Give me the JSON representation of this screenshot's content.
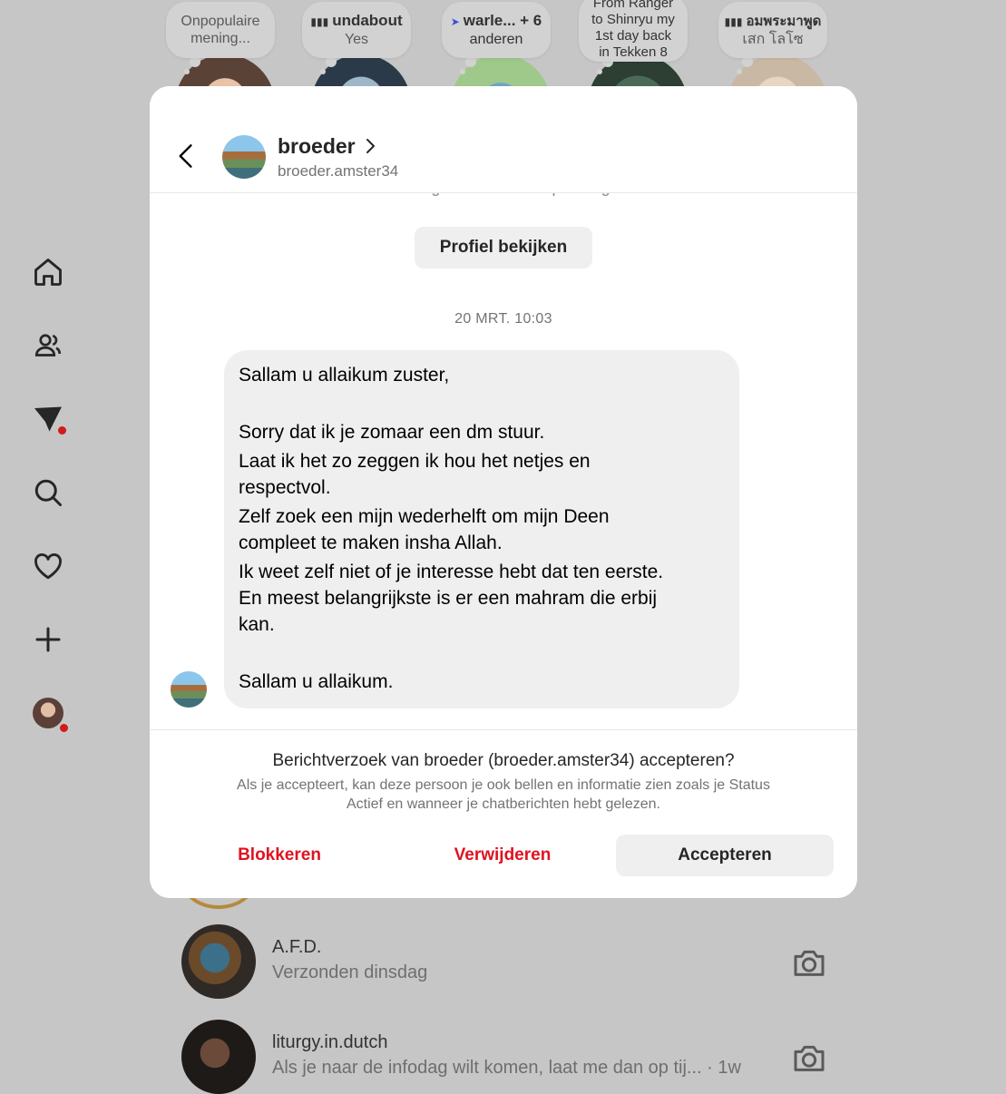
{
  "notes": [
    {
      "lines": [
        "Onpopulaire",
        "mening..."
      ],
      "music": false
    },
    {
      "top": "undabout",
      "bottom": "Yes",
      "music": true
    },
    {
      "top": "warle... + 6",
      "bottom": "anderen",
      "location": true
    },
    {
      "lines": [
        "From Ranger",
        "to Shinryu my",
        "1st day back",
        "in Tekken 8"
      ],
      "music": false
    },
    {
      "top": "อมพระมาพูด",
      "bottom": "เสก โลโซ",
      "music": true
    }
  ],
  "sidebar": {
    "items": [
      "home-icon",
      "contacts-icon",
      "messages-icon",
      "search-icon",
      "heart-icon",
      "create-icon",
      "profile-avatar"
    ]
  },
  "dm": {
    "header": {
      "name": "broeder",
      "handle": "broeder.amster34"
    },
    "peek_text": "Jullie volgen elkaar niet op Instagram",
    "profile_button": "Profiel bekijken",
    "timestamp": "20 MRT. 10:03",
    "message_lines": [
      "Sallam u allaikum zuster,",
      "Sorry dat ik je zomaar een dm stuur.",
      "Laat ik het zo zeggen ik hou het netjes en",
      "respectvol.",
      "Zelf zoek een mijn wederhelft om mijn Deen",
      "compleet te maken insha Allah.",
      "Ik weet zelf niet of je interesse hebt dat ten eerste.",
      "En meest belangrijkste is er een mahram die erbij",
      "kan.",
      "Sallam u allaikum."
    ],
    "request": {
      "title": "Berichtverzoek van broeder (broeder.amster34) accepteren?",
      "subtitle_line1": "Als je accepteert, kan deze persoon je ook bellen en informatie zien zoals je Status",
      "subtitle_line2": "Actief en wanneer je chatberichten hebt gelezen."
    },
    "actions": {
      "block": "Blokkeren",
      "delete": "Verwijderen",
      "accept": "Accepteren"
    }
  },
  "threads": [
    {
      "name": "A.F.D.",
      "preview": "Verzonden dinsdag"
    },
    {
      "name": "liturgy.in.dutch",
      "preview": "Als je naar de infodag wilt komen, laat me dan op tij... · 1w"
    }
  ],
  "colors": {
    "danger": "#e0121f",
    "notification_dot": "#d21a1a",
    "bubble": "#efefef",
    "overlay": "#c6c6c6"
  }
}
